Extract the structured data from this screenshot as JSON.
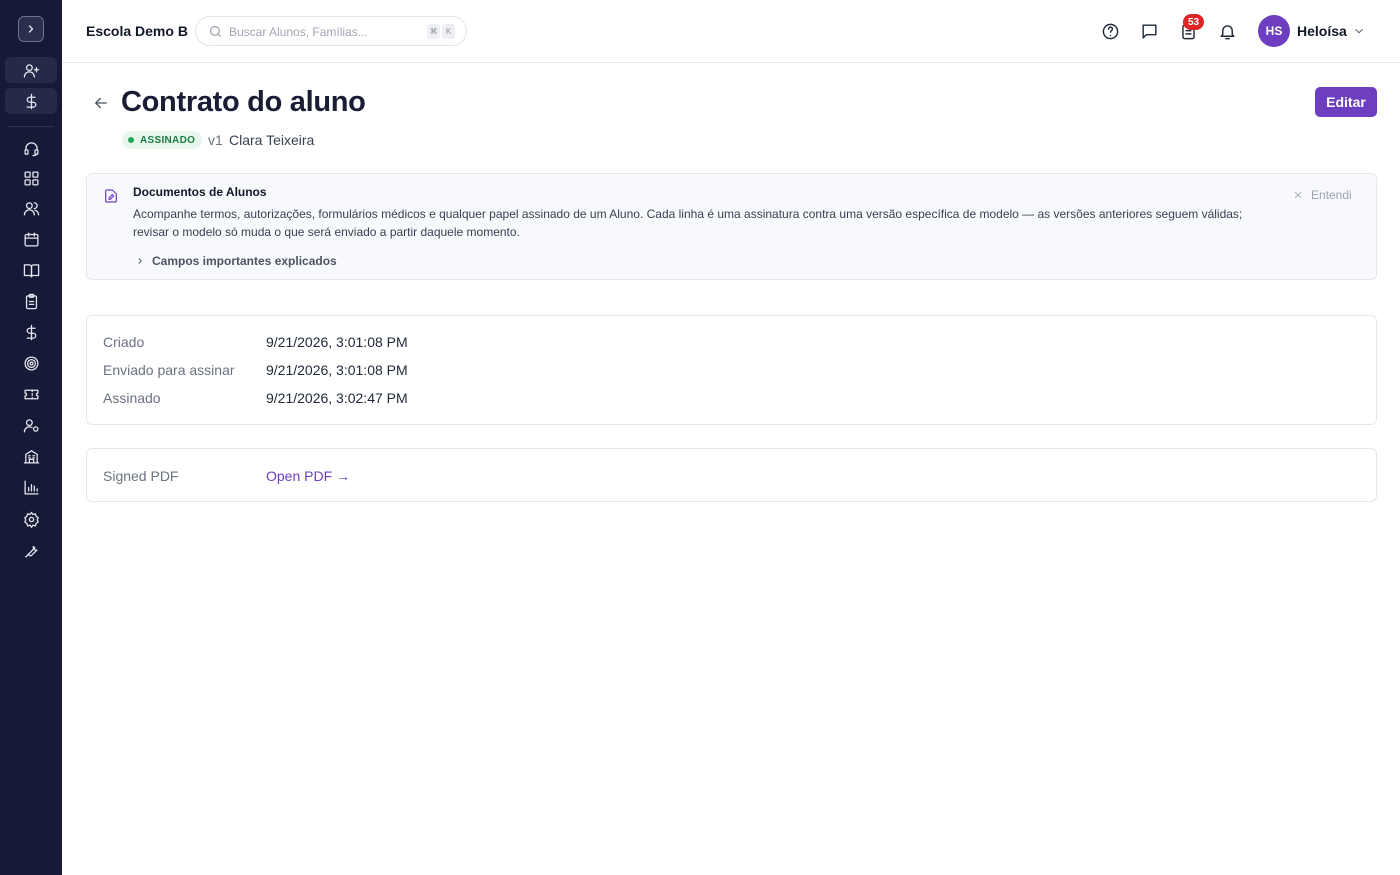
{
  "header": {
    "school_name": "Escola Demo B",
    "search_placeholder": "Buscar Alunos, Famílias...",
    "shortcut_keys": [
      "⌘",
      "K"
    ],
    "notification_count": "53",
    "user_initials": "HS",
    "user_name": "Heloísa"
  },
  "sidebar": {
    "items": [
      "add-user",
      "billing",
      "support",
      "dashboard",
      "people",
      "calendar",
      "library",
      "clipboard",
      "finance",
      "goals",
      "tickets",
      "user-settings",
      "buildings",
      "reports",
      "settings",
      "tools"
    ]
  },
  "page": {
    "title": "Contrato do aluno",
    "status_label": "ASSINADO",
    "version": "v1",
    "student_name": "Clara Teixeira",
    "edit_label": "Editar"
  },
  "info_box": {
    "title": "Documentos de Alunos",
    "description": "Acompanhe termos, autorizações, formulários médicos e qualquer papel assinado de um Aluno. Cada linha é uma assinatura contra uma versão específica de modelo — as versões anteriores seguem válidas; revisar o modelo só muda o que será enviado a partir daquele momento.",
    "fields_toggle": "Campos importantes explicados",
    "dismiss_label": "Entendi"
  },
  "dates": [
    {
      "label": "Criado",
      "value": "9/21/2026, 3:01:08 PM"
    },
    {
      "label": "Enviado para assinar",
      "value": "9/21/2026, 3:01:08 PM"
    },
    {
      "label": "Assinado",
      "value": "9/21/2026, 3:02:47 PM"
    }
  ],
  "pdf": {
    "label": "Signed PDF",
    "link_text": "Open PDF →"
  },
  "colors": {
    "sidebar_bg": "#161a36",
    "accent": "#6d3fc0",
    "status_green": "#22a85a",
    "badge_red": "#dc2626"
  }
}
